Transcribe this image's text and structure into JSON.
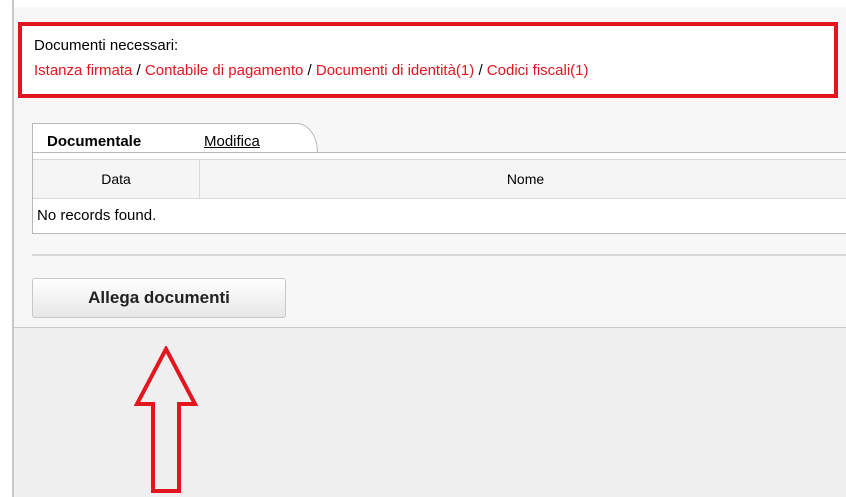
{
  "notice": {
    "title": "Documenti necessari:",
    "links": [
      "Istanza firmata",
      "Contabile di pagamento",
      "Documenti di identità(1)",
      "Codici fiscali(1)"
    ],
    "separator": " / ",
    "border_color": "#e3151f",
    "link_color": "#e3151f"
  },
  "documentale": {
    "tab_title": "Documentale",
    "edit_link": "Modifica",
    "columns": [
      "Data",
      "Nome"
    ],
    "empty_message": "No records found."
  },
  "actions": {
    "attach_label": "Allega documenti"
  },
  "annotation": {
    "icon": "up-arrow-icon",
    "color": "#e3151f"
  }
}
